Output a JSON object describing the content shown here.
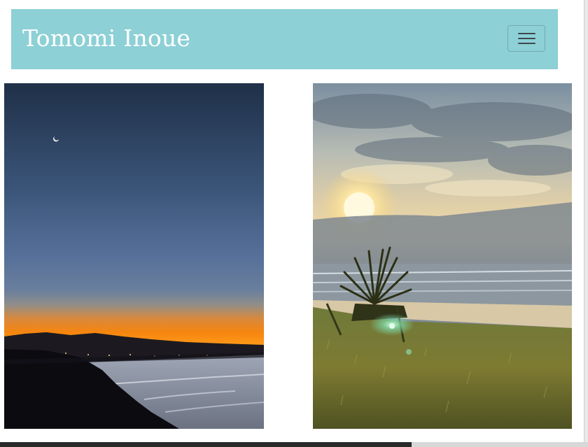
{
  "header": {
    "brand": "Tomomi Inoue",
    "menu_icon": "hamburger-menu-icon"
  },
  "colors": {
    "navbar_bg": "#8dd0d6",
    "brand_text": "#ffffff"
  },
  "gallery": {
    "photos": [
      {
        "name": "twilight-coast-photo"
      },
      {
        "name": "sunrise-beach-photo"
      }
    ]
  }
}
